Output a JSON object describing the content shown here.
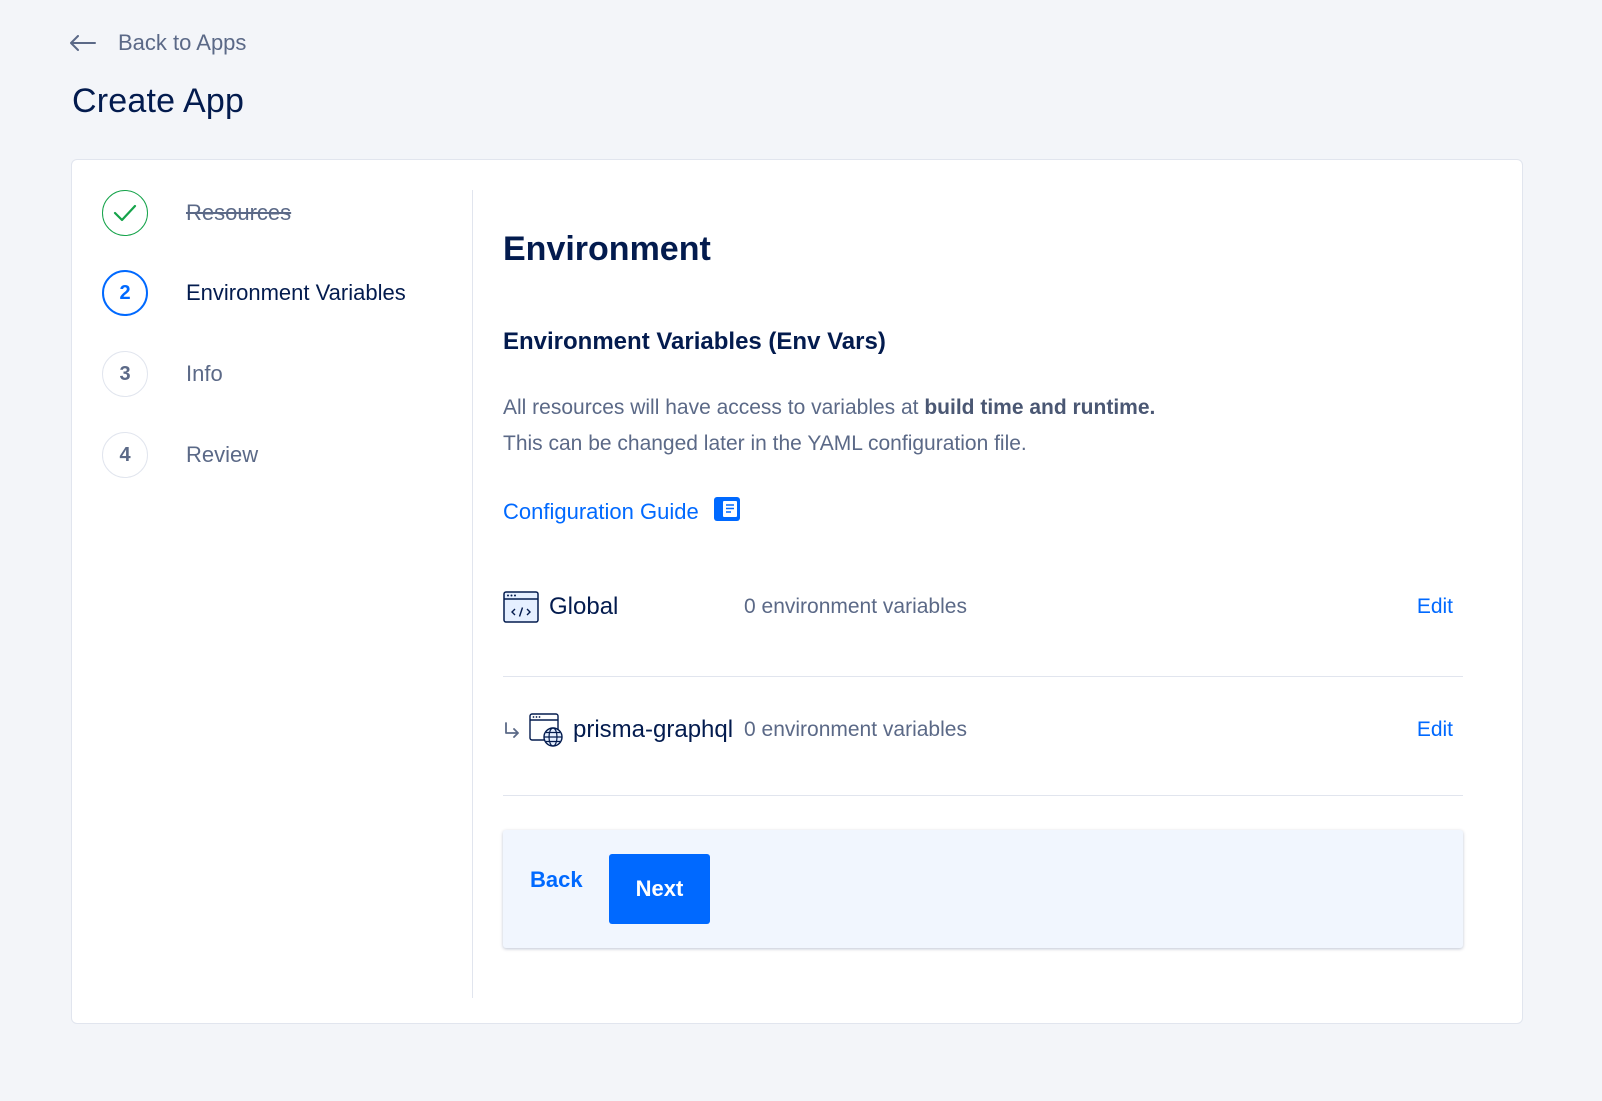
{
  "nav": {
    "back_label": "Back to Apps"
  },
  "page": {
    "title": "Create App"
  },
  "steps": [
    {
      "number": "",
      "label": "Resources",
      "state": "done"
    },
    {
      "number": "2",
      "label": "Environment Variables",
      "state": "active"
    },
    {
      "number": "3",
      "label": "Info",
      "state": "pending"
    },
    {
      "number": "4",
      "label": "Review",
      "state": "pending"
    }
  ],
  "environment": {
    "title": "Environment",
    "subtitle": "Environment Variables (Env Vars)",
    "desc_line1_prefix": "All resources will have access to variables at ",
    "desc_line1_bold": "build time and runtime.",
    "desc_line2": "This can be changed later in the YAML configuration file.",
    "guide_label": "Configuration Guide"
  },
  "rows": [
    {
      "name": "Global",
      "count": "0 environment variables",
      "edit": "Edit",
      "icon": "code-window-icon"
    },
    {
      "name": "prisma-graphql",
      "count": "0 environment variables",
      "edit": "Edit",
      "icon": "web-service-icon"
    }
  ],
  "footer": {
    "back_label": "Back",
    "next_label": "Next"
  },
  "colors": {
    "accent": "#0069ff",
    "success": "#15a34a",
    "text": "#031b4e",
    "muted": "#5b6987"
  }
}
